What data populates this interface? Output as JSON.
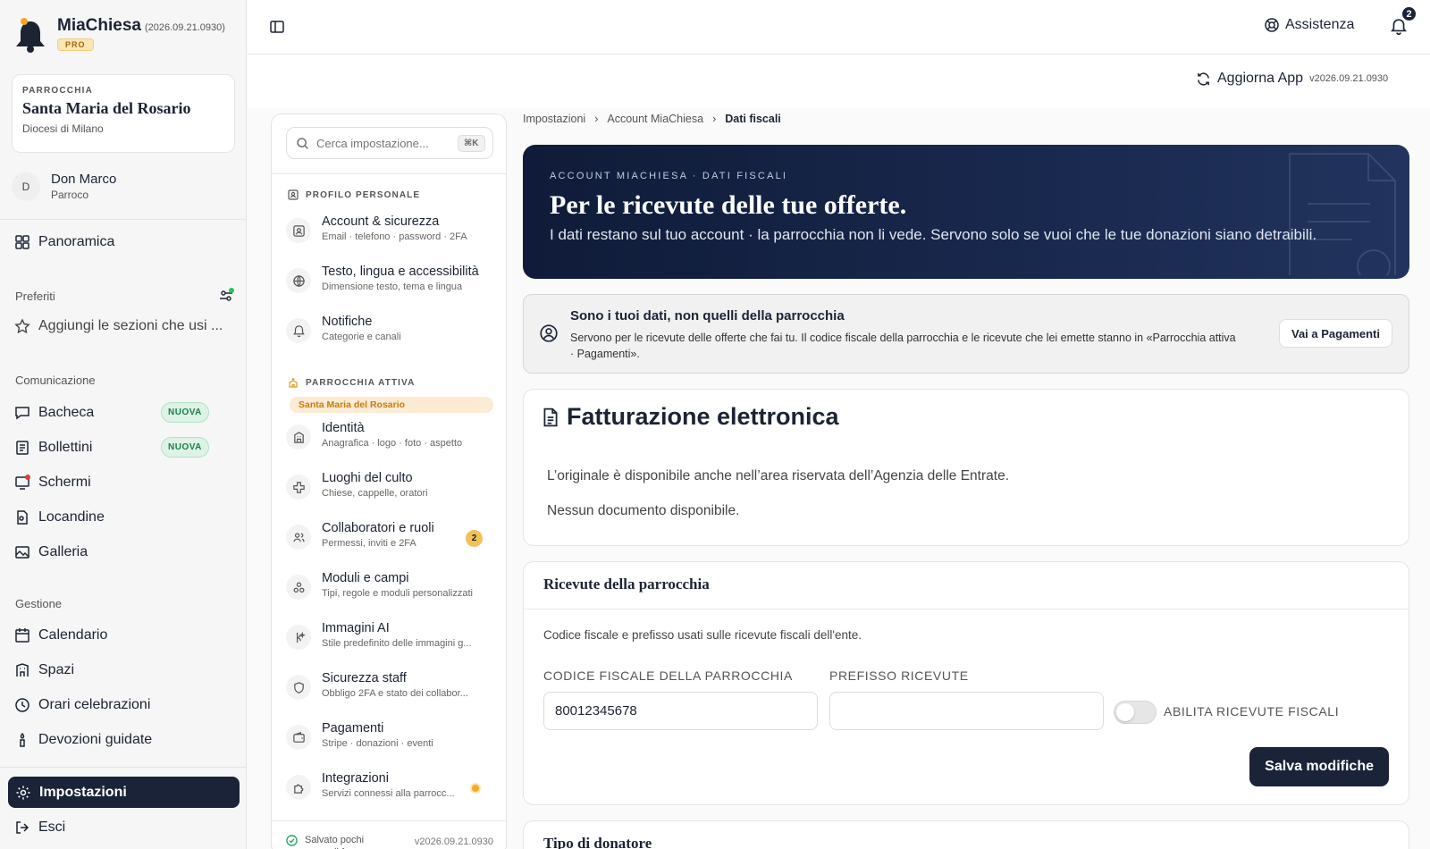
{
  "brand": {
    "name": "MiaChiesa",
    "version": "(2026.09.21.0930)",
    "badge": "PRO"
  },
  "parish": {
    "label": "PARROCCHIA",
    "name": "Santa Maria del Rosario",
    "diocese": "Diocesi di Milano"
  },
  "user": {
    "initial": "D",
    "name": "Don Marco",
    "role": "Parroco"
  },
  "nav": {
    "overview": "Panoramica",
    "favorites_label": "Preferiti",
    "favorites_add": "Aggiungi le sezioni che usi ...",
    "communication_label": "Comunicazione",
    "communication": [
      {
        "label": "Bacheca",
        "badge": "NUOVA"
      },
      {
        "label": "Bollettini",
        "badge": "NUOVA"
      },
      {
        "label": "Schermi"
      },
      {
        "label": "Locandine"
      },
      {
        "label": "Galleria"
      }
    ],
    "management_label": "Gestione",
    "management": [
      "Calendario",
      "Spazi",
      "Orari celebrazioni",
      "Devozioni guidate"
    ],
    "settings": "Impostazioni",
    "logout": "Esci"
  },
  "topbar": {
    "help": "Assistenza",
    "notifications_count": "2",
    "update_app": "Aggiorna App",
    "update_version": "v2026.09.21.0930"
  },
  "settings_panel": {
    "search_placeholder": "Cerca impostazione...",
    "search_shortcut": "⌘K",
    "personal_head": "PROFILO PERSONALE",
    "personal": [
      {
        "title": "Account & sicurezza",
        "sub": "Email · telefono · password · 2FA"
      },
      {
        "title": "Testo, lingua e accessibilità",
        "sub": "Dimensione testo, tema e lingua"
      },
      {
        "title": "Notifiche",
        "sub": "Categorie e canali"
      }
    ],
    "parish_head": "PARROCCHIA ATTIVA",
    "parish_chip": "Santa Maria del Rosario",
    "parish_items": [
      {
        "title": "Identità",
        "sub": "Anagrafica · logo · foto · aspetto"
      },
      {
        "title": "Luoghi del culto",
        "sub": "Chiese, cappelle, oratori"
      },
      {
        "title": "Collaboratori e ruoli",
        "sub": "Permessi, inviti e 2FA",
        "count": "2"
      },
      {
        "title": "Moduli e campi",
        "sub": "Tipi, regole e moduli personalizzati"
      },
      {
        "title": "Immagini AI",
        "sub": "Stile predefinito delle immagini g..."
      },
      {
        "title": "Sicurezza staff",
        "sub": "Obbligo 2FA e stato dei collabor..."
      },
      {
        "title": "Pagamenti",
        "sub": "Stripe · donazioni · eventi"
      },
      {
        "title": "Integrazioni",
        "sub": "Servizi connessi alla parrocc..."
      }
    ],
    "footer_saved": "Salvato pochi secondi fa",
    "footer_version": "v2026.09.21.0930"
  },
  "breadcrumb": [
    "Impostazioni",
    "Account MiaChiesa",
    "Dati fiscali"
  ],
  "hero": {
    "kicker": "ACCOUNT MIACHIESA · DATI FISCALI",
    "title": "Per le ricevute delle tue offerte.",
    "subtitle": "I dati restano sul tuo account · la parrocchia non li vede. Servono solo se vuoi che le tue donazioni siano detraibili."
  },
  "notice": {
    "title": "Sono i tuoi dati, non quelli della parrocchia",
    "body": "Servono per le ricevute delle offerte che fai tu. Il codice fiscale della parrocchia e le ricevute che lei emette stanno in «Parrocchia attiva · Pagamenti».",
    "button": "Vai a Pagamenti"
  },
  "invoicing": {
    "title": "Fatturazione elettronica",
    "line1": "L’originale è disponibile anche nell’area riservata dell’Agenzia delle Entrate.",
    "line2": "Nessun documento disponibile."
  },
  "receipts": {
    "title": "Ricevute della parrocchia",
    "description": "Codice fiscale e prefisso usati sulle ricevute fiscali dell'ente.",
    "tax_code_label": "CODICE FISCALE DELLA PARROCCHIA",
    "tax_code_value": "80012345678",
    "prefix_label": "PREFISSO RICEVUTE",
    "prefix_value": "",
    "toggle_label": "ABILITA RICEVUTE FISCALI",
    "save": "Salva modifiche"
  },
  "donor": {
    "title": "Tipo di donatore"
  },
  "colors": {
    "navy": "#1a2337",
    "accent_amber": "#f1c15a",
    "new_green": "#16804a"
  }
}
